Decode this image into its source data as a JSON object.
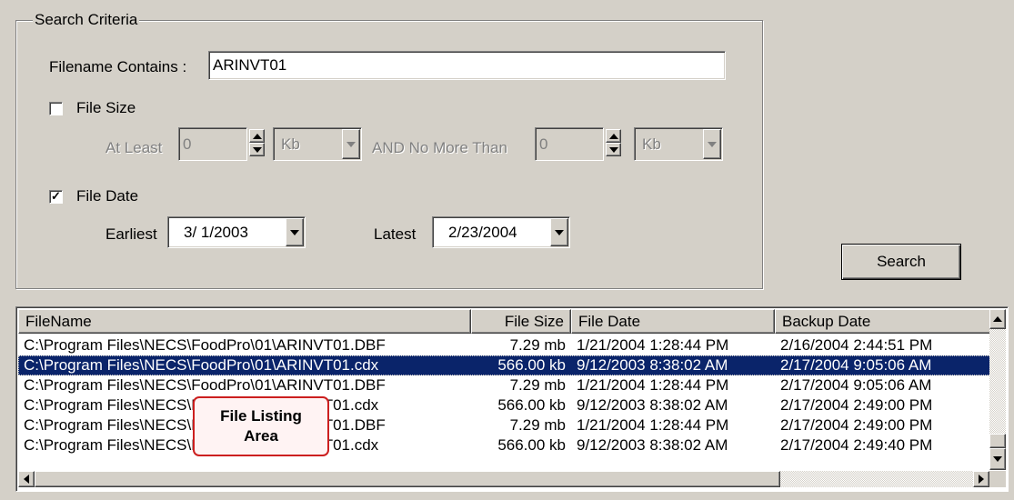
{
  "search_criteria": {
    "group_title": "Search Criteria",
    "filename_label": "Filename Contains :",
    "filename_value": "ARINVT01",
    "file_size": {
      "checkbox_label": "File Size",
      "checked": "",
      "at_least_label": "At Least",
      "at_least_value": "0",
      "at_least_unit": "Kb",
      "no_more_than_label": "AND No More Than",
      "no_more_than_value": "0",
      "no_more_than_unit": "Kb"
    },
    "file_date": {
      "checkbox_label": "File Date",
      "checked": "✓",
      "earliest_label": "Earliest",
      "earliest_value": "3/ 1/2003",
      "latest_label": "Latest",
      "latest_value": "2/23/2004"
    }
  },
  "search_button_label": "Search",
  "file_list": {
    "columns": [
      "FileName",
      "File Size",
      "File Date",
      "Backup Date"
    ],
    "rows": [
      {
        "name": "C:\\Program Files\\NECS\\FoodPro\\01\\ARINVT01.DBF",
        "size": "7.29 mb",
        "date": "1/21/2004 1:28:44 PM",
        "backup": "2/16/2004 2:44:51 PM"
      },
      {
        "name": "C:\\Program Files\\NECS\\FoodPro\\01\\ARINVT01.cdx",
        "size": "566.00 kb",
        "date": "9/12/2003 8:38:02 AM",
        "backup": "2/17/2004 9:05:06 AM"
      },
      {
        "name": "C:\\Program Files\\NECS\\FoodPro\\01\\ARINVT01.DBF",
        "size": "7.29 mb",
        "date": "1/21/2004 1:28:44 PM",
        "backup": "2/17/2004 9:05:06 AM"
      },
      {
        "name": "C:\\Program Files\\NECS\\FoodPro\\01\\ARINVT01.cdx",
        "size": "566.00 kb",
        "date": "9/12/2003 8:38:02 AM",
        "backup": "2/17/2004 2:49:00 PM"
      },
      {
        "name": "C:\\Program Files\\NECS\\FoodPro\\01\\ARINVT01.DBF",
        "size": "7.29 mb",
        "date": "1/21/2004 1:28:44 PM",
        "backup": "2/17/2004 2:49:00 PM"
      },
      {
        "name": "C:\\Program Files\\NECS\\FoodPro\\01\\ARINVT01.cdx",
        "size": "566.00 kb",
        "date": "9/12/2003 8:38:02 AM",
        "backup": "2/17/2004 2:49:40 PM"
      }
    ],
    "selected_row": 1
  },
  "callout": {
    "line1": "File Listing",
    "line2": "Area"
  },
  "colors": {
    "window_bg": "#d4d0c8",
    "selection": "#0a246a",
    "callout_border": "#cc1f1f"
  }
}
